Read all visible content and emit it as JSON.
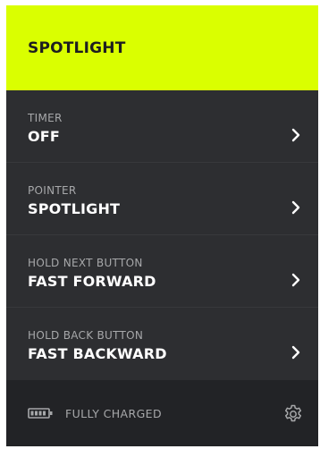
{
  "header": {
    "title": "SPOTLIGHT"
  },
  "settings": [
    {
      "label": "TIMER",
      "value": "OFF"
    },
    {
      "label": "POINTER",
      "value": "SPOTLIGHT"
    },
    {
      "label": "HOLD NEXT BUTTON",
      "value": "FAST FORWARD"
    },
    {
      "label": "HOLD BACK BUTTON",
      "value": "FAST BACKWARD"
    }
  ],
  "footer": {
    "battery_icon": "battery-icon",
    "status": "FULLY CHARGED",
    "settings_icon": "gear-icon"
  },
  "colors": {
    "accent": "#daff00",
    "panel": "#2d2e31",
    "footer": "#222326",
    "label": "#a7a8aa",
    "value": "#ffffff"
  }
}
